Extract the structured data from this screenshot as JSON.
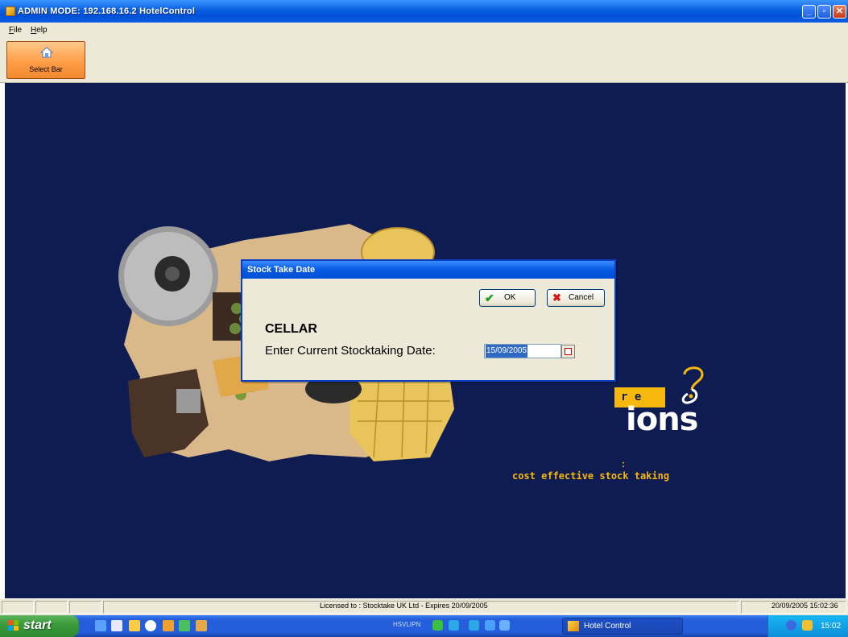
{
  "window": {
    "title": "ADMIN MODE: 192.168.16.2 HotelControl",
    "minimize_glyph": "_",
    "maximize_glyph": "▫",
    "close_glyph": "✕"
  },
  "menu": {
    "file": "File",
    "help": "Help"
  },
  "toolbar": {
    "select_bar_label": "Select Bar",
    "select_bar_icon": "home-icon"
  },
  "splash": {
    "logo_box_text": "r e",
    "logo_word": "ions",
    "tagline": "cost effective stock taking",
    "tag_dot": ":"
  },
  "dialog": {
    "title": "Stock Take Date",
    "ok_label": "OK",
    "cancel_label": "Cancel",
    "ok_icon": "✔",
    "cancel_icon": "✖",
    "heading": "CELLAR",
    "prompt": "Enter Current Stocktaking Date:",
    "date_value": "15/09/2005"
  },
  "statusbar": {
    "license": "Licensed to : Stocktake UK Ltd - Expires 20/09/2005",
    "datetime": "20/09/2005 15:02:36"
  },
  "taskbar": {
    "start_label": "start",
    "task_label": "Hotel Control",
    "clock": "15:02",
    "lang_label": "HSVLIPN"
  },
  "colors": {
    "main_background": "#0f1c52",
    "logo_yellow": "#f6b80d",
    "xp_blue": "#0050d8"
  }
}
